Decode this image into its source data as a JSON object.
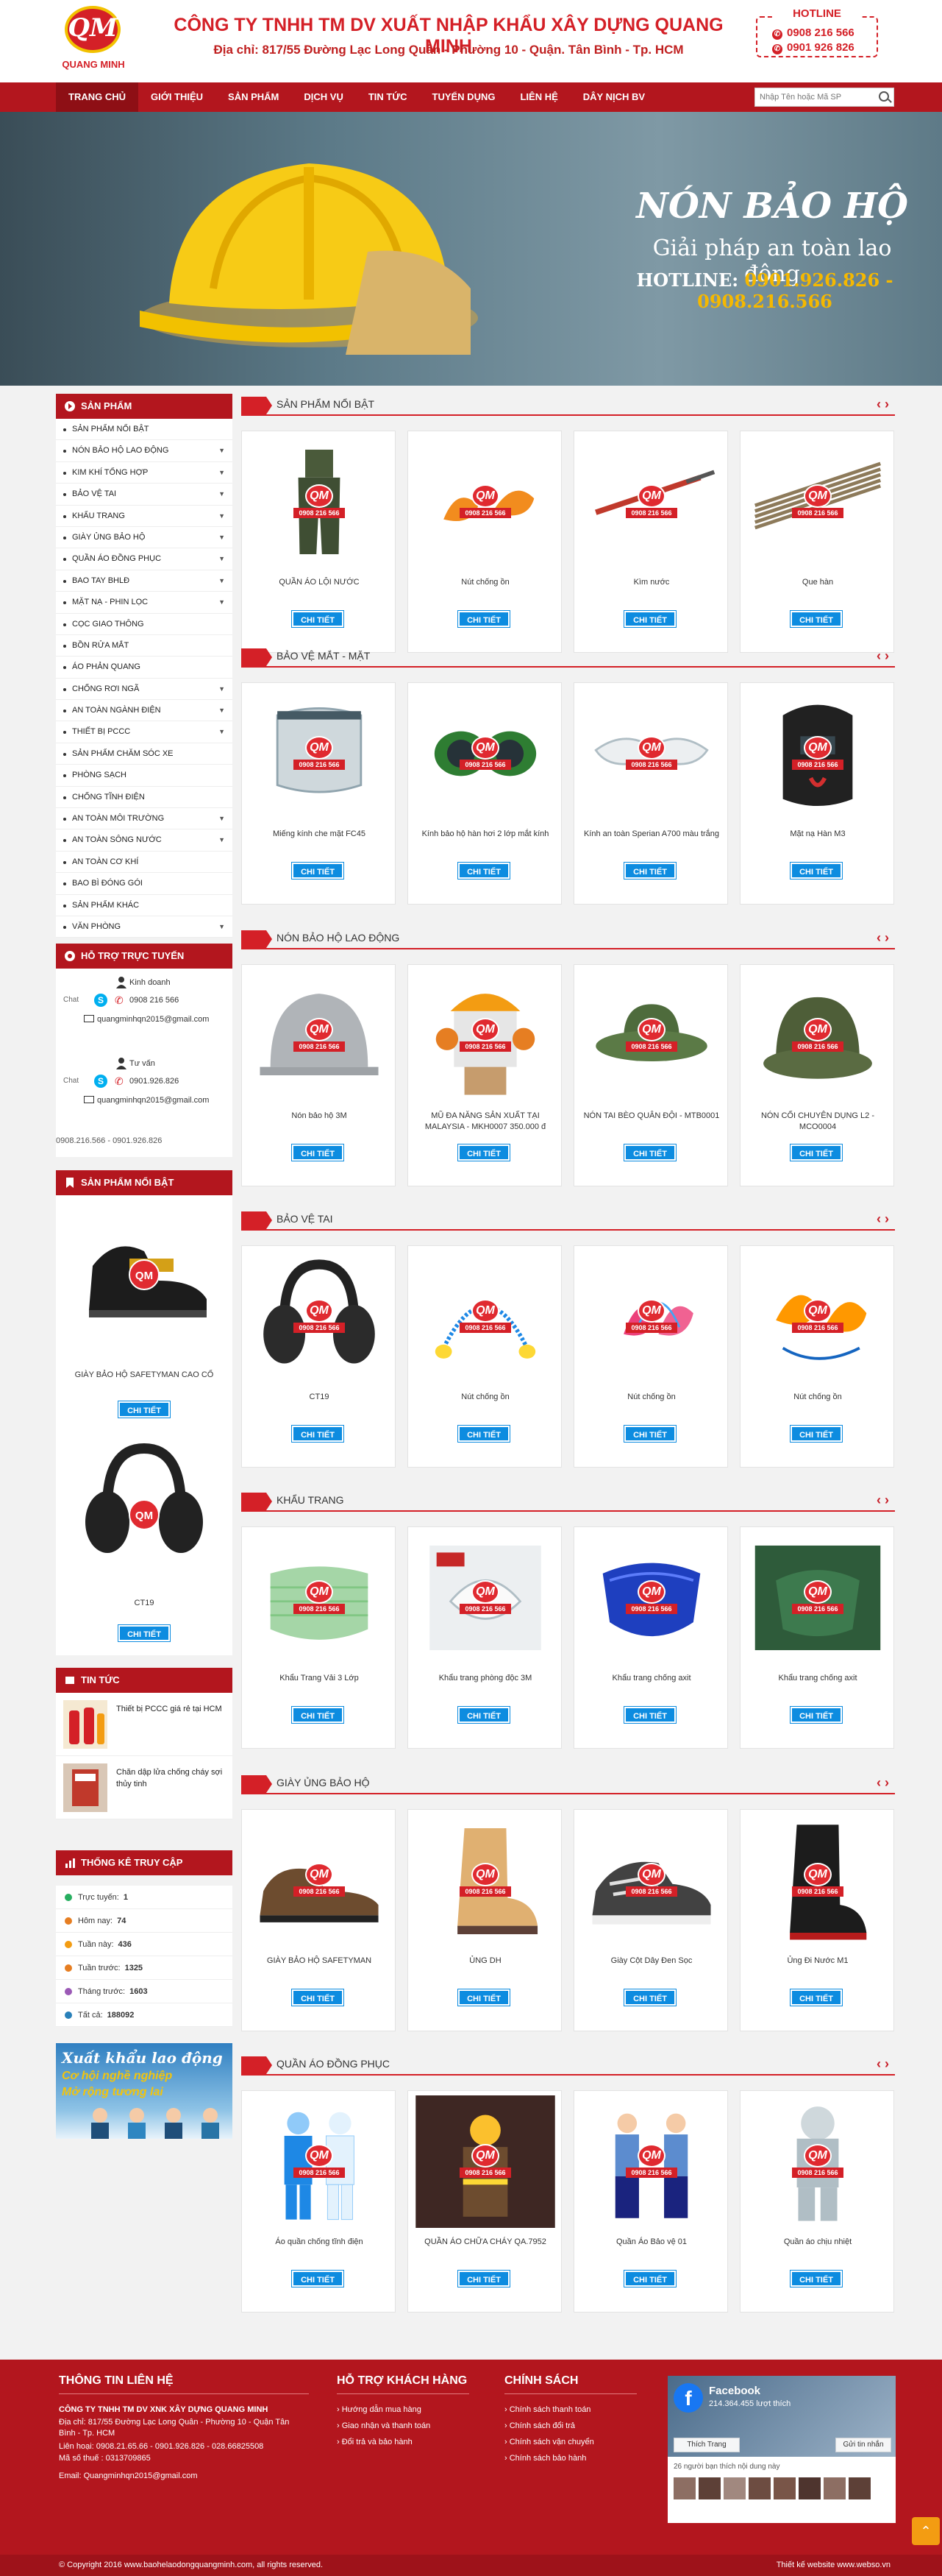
{
  "header": {
    "logo_text": "QM",
    "logo_name": "QUANG MINH",
    "company": "CÔNG TY TNHH TM DV XUẤT NHẬP KHẨU XÂY DỰNG QUANG MINH",
    "address": "Địa chỉ:  817/55 Đường Lạc Long Quân - Phường 10 - Quận. Tân Bình - Tp. HCM",
    "hotline_label": "HOTLINE",
    "hotline_1": "0908 216 566",
    "hotline_2": "0901 926 826"
  },
  "nav": {
    "items": [
      "TRANG CHỦ",
      "GIỚI THIỆU",
      "SẢN PHẨM",
      "DỊCH VỤ",
      "TIN TỨC",
      "TUYỂN DỤNG",
      "LIÊN HỆ",
      "DÂY NỊCH BV"
    ],
    "search_placeholder": "Nhập Tên hoặc Mã SP"
  },
  "banner": {
    "title": "NÓN BẢO HỘ",
    "subtitle": "Giải pháp an toàn lao động",
    "hotline_label": "HOTLINE:",
    "hotline_numbers": "0901.926.826  - 0908.216.566"
  },
  "sidebar": {
    "products_title": "SẢN PHẨM",
    "categories": [
      "SẢN PHẨM NỔI BẬT",
      "NÓN BẢO HỘ LAO ĐỘNG",
      "KIM KHÍ TỔNG HỢP",
      "BẢO VỆ TAI",
      "KHẨU TRANG",
      "GIÀY ỦNG BẢO HỘ",
      "QUẦN ÁO ĐỒNG PHỤC",
      "BAO TAY BHLĐ",
      "MẶT NẠ - PHIN LỌC",
      "CỌC GIAO THÔNG",
      "BỒN RỬA MẮT",
      "ÁO PHẢN QUANG",
      "CHỐNG RƠI NGÃ",
      "AN TOÀN NGÀNH ĐIỆN",
      "THIẾT BỊ PCCC",
      "SẢN PHẨM CHĂM SÓC XE",
      "PHÒNG SẠCH",
      "CHỐNG TĨNH ĐIỆN",
      "AN TOÀN MÔI TRƯỜNG",
      "AN TOÀN SÔNG NƯỚC",
      "AN TOÀN CƠ KHÍ",
      "BAO BÌ ĐÓNG GÓI",
      "SẢN PHẨM KHÁC",
      "VĂN PHÒNG"
    ],
    "category_arrows": [
      false,
      true,
      true,
      true,
      true,
      true,
      true,
      true,
      true,
      false,
      false,
      false,
      true,
      true,
      true,
      false,
      false,
      false,
      true,
      true,
      false,
      false,
      false,
      true
    ],
    "support_title": "HỖ TRỢ TRỰC TUYẾN",
    "support": [
      {
        "role": "Kinh doanh",
        "chat": "Chat",
        "phone": "0908 216 566",
        "email": "quangminhqn2015@gmail.com"
      },
      {
        "role": "Tư vấn",
        "chat": "Chat",
        "phone": "0901.926.826",
        "email": "quangminhqn2015@gmail.com"
      }
    ],
    "support_numbers": "0908.216.566 - 0901.926.826",
    "featured_title": "SẢN PHẨM NỔI BẬT",
    "featured": [
      {
        "name": "GIÀY BẢO HỘ SAFETYMAN CAO CỔ",
        "button": "CHI TIẾT"
      },
      {
        "name": "CT19",
        "button": "CHI TIẾT"
      }
    ],
    "news_title": "TIN TỨC",
    "news": [
      {
        "title": "Thiết bị PCCC giá rẻ tại HCM"
      },
      {
        "title": "Chăn dập lửa chống cháy sợi thủy tinh"
      }
    ],
    "stats_title": "THỐNG KÊ TRUY CẬP",
    "stats": [
      {
        "label": "Trực tuyến:",
        "value": "1",
        "color": "#27ae60"
      },
      {
        "label": "Hôm nay:",
        "value": "74",
        "color": "#e67e22"
      },
      {
        "label": "Tuần này:",
        "value": "436",
        "color": "#f39c12"
      },
      {
        "label": "Tuần trước:",
        "value": "1325",
        "color": "#e67e22"
      },
      {
        "label": "Tháng trước:",
        "value": "1603",
        "color": "#9b59b6"
      },
      {
        "label": "Tất cả:",
        "value": "188092",
        "color": "#2980b9"
      }
    ],
    "ad_line1": "Xuất khẩu lao động",
    "ad_line2": "Cơ hội nghề nghiệp",
    "ad_line3": "Mở rộng tương lai"
  },
  "sections": [
    {
      "title": "SẢN PHẨM NỔI BẬT",
      "products": [
        {
          "name": "QUẦN ÁO LỘI NƯỚC",
          "button": "CHI TIẾT",
          "icon": "wader"
        },
        {
          "name": "Nút chống ồn",
          "button": "CHI TIẾT",
          "icon": "earplug"
        },
        {
          "name": "Kìm nước",
          "button": "CHI TIẾT",
          "icon": "pliers"
        },
        {
          "name": "Que hàn",
          "button": "CHI TIẾT",
          "icon": "rods"
        }
      ]
    },
    {
      "title": "BẢO VỆ MẮT - MẶT",
      "products": [
        {
          "name": "Miếng kính che mặt FC45",
          "button": "CHI TIẾT",
          "icon": "visor"
        },
        {
          "name": "Kính bảo hộ hàn hơi 2 lớp mắt kính",
          "button": "CHI TIẾT",
          "icon": "goggles"
        },
        {
          "name": "Kính an toàn Sperian A700 màu trắng",
          "button": "CHI TIẾT",
          "icon": "glasses"
        },
        {
          "name": "Mặt nạ Hàn M3",
          "button": "CHI TIẾT",
          "icon": "weldmask"
        }
      ]
    },
    {
      "title": "NÓN BẢO HỘ LAO ĐỘNG",
      "products": [
        {
          "name": "Nón bảo hộ 3M",
          "button": "CHI TIẾT",
          "icon": "helmet"
        },
        {
          "name": "MŨ ĐA NĂNG SẢN XUẤT TẠI MALAYSIA - MKH0007 350.000 đ",
          "button": "CHI TIẾT",
          "icon": "helmetvisor"
        },
        {
          "name": "NÓN TAI BÈO QUÂN ĐỘI - MTB0001",
          "button": "CHI TIẾT",
          "icon": "bucket"
        },
        {
          "name": "NÓN CỐI CHUYÊN DỤNG L2 - MCO0004",
          "button": "CHI TIẾT",
          "icon": "pith"
        }
      ]
    },
    {
      "title": "BẢO VỆ TAI",
      "products": [
        {
          "name": "CT19",
          "button": "CHI TIẾT",
          "icon": "earmuff"
        },
        {
          "name": "Nút chống ồn",
          "button": "CHI TIẾT",
          "icon": "corded"
        },
        {
          "name": "Nút chống ồn",
          "button": "CHI TIẾT",
          "icon": "pinkplug"
        },
        {
          "name": "Nút chống ồn",
          "button": "CHI TIẾT",
          "icon": "orangeplug"
        }
      ]
    },
    {
      "title": "KHẨU TRANG",
      "products": [
        {
          "name": "Khẩu Trang Vải 3 Lớp",
          "button": "CHI TIẾT",
          "icon": "clothmask"
        },
        {
          "name": "Khẩu trang phòng độc 3M",
          "button": "CHI TIẾT",
          "icon": "n95"
        },
        {
          "name": "Khẩu trang chống axit",
          "button": "CHI TIẾT",
          "icon": "bluemask"
        },
        {
          "name": "Khẩu trang chống axit",
          "button": "CHI TIẾT",
          "icon": "greenmask"
        }
      ]
    },
    {
      "title": "GIÀY ỦNG BẢO HỘ",
      "products": [
        {
          "name": "GIÀY BẢO HỘ SAFETYMAN",
          "button": "CHI TIẾT",
          "icon": "shoe"
        },
        {
          "name": "ỦNG DH",
          "button": "CHI TIẾT",
          "icon": "boot"
        },
        {
          "name": "Giày Cột Dây Đen Sọc",
          "button": "CHI TIẾT",
          "icon": "sneaker"
        },
        {
          "name": "Ủng Đi Nước M1",
          "button": "CHI TIẾT",
          "icon": "rainboot"
        }
      ]
    },
    {
      "title": "QUẦN ÁO ĐỒNG PHỤC",
      "products": [
        {
          "name": "Áo quần chống tĩnh điện",
          "button": "CHI TIẾT",
          "icon": "cleansuit"
        },
        {
          "name": "QUẦN ÁO CHỮA CHÁY QA.7952",
          "button": "CHI TIẾT",
          "icon": "firesuit"
        },
        {
          "name": "Quần Áo Bảo vệ 01",
          "button": "CHI TIẾT",
          "icon": "guard"
        },
        {
          "name": "Quần áo chịu nhiệt",
          "button": "CHI TIẾT",
          "icon": "heatsuit"
        }
      ]
    }
  ],
  "watermark": {
    "logo": "QM",
    "phone": "0908 216 566"
  },
  "footer": {
    "contact_title": "THÔNG TIN LIÊN HỆ",
    "contact_company": "CÔNG TY TNHH TM DV XNK XÂY DỰNG QUANG MINH",
    "contact_address": "Địa chỉ:  817/55 Đường Lạc Long Quân - Phường 10 - Quận Tân Bình - Tp. HCM",
    "contact_phone": "Liên hoại: 0908.21.65.66 - 0901.926.826 - 028.66825508",
    "contact_tax": "Mã số thuế : 0313709865",
    "contact_email": "Email: Quangminhqn2015@gmail.com",
    "support_title": "HỖ TRỢ KHÁCH HÀNG",
    "support_links": [
      "Hướng dẫn mua hàng",
      "Giao nhận và thanh toán",
      "Đổi trả và bảo hành"
    ],
    "policy_title": "CHÍNH SÁCH",
    "policy_links": [
      "Chính sách thanh toán",
      "Chính sách đổi trả",
      "Chính sách vận chuyển",
      "Chính sách bảo hành"
    ],
    "fb_name": "Facebook",
    "fb_likes": "214.364.455 lượt thích",
    "fb_like_btn": "Thích Trang",
    "fb_share_btn": "Gửi tin nhắn",
    "fb_friends": "26 người bạn thích nội dung này",
    "copyright": "© Copyright 2016 www.baohelaodongquangminh.com, all rights reserved.",
    "designer": "Thiết kế website www.webso.vn"
  }
}
